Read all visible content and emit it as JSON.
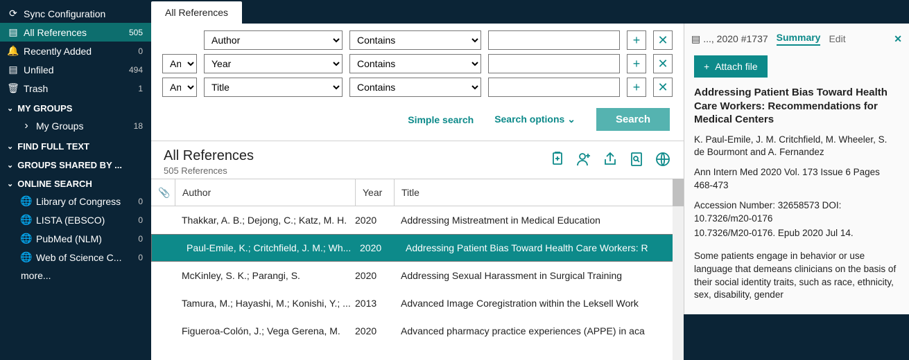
{
  "sidebar": {
    "sync": "Sync Configuration",
    "items": [
      {
        "icon": "⎘",
        "label": "All References",
        "count": "505",
        "active": true
      },
      {
        "icon": "🔔",
        "label": "Recently Added",
        "count": "0"
      },
      {
        "icon": "⎘",
        "label": "Unfiled",
        "count": "494"
      },
      {
        "icon": "🗑",
        "label": "Trash",
        "count": "1"
      }
    ],
    "my_groups_header": "MY GROUPS",
    "my_groups": [
      {
        "label": "My Groups",
        "count": "18"
      }
    ],
    "find_full_text_header": "FIND FULL TEXT",
    "groups_shared_header": "GROUPS SHARED BY ...",
    "online_search_header": "ONLINE SEARCH",
    "online_sources": [
      {
        "label": "Library of Congress",
        "count": "0"
      },
      {
        "label": "LISTA (EBSCO)",
        "count": "0"
      },
      {
        "label": "PubMed (NLM)",
        "count": "0"
      },
      {
        "label": "Web of Science C...",
        "count": "0"
      }
    ],
    "more": "more..."
  },
  "tab": {
    "label": "All References"
  },
  "search": {
    "rows": [
      {
        "joiner": "",
        "field": "Author",
        "op": "Contains",
        "value": ""
      },
      {
        "joiner": "And",
        "field": "Year",
        "op": "Contains",
        "value": ""
      },
      {
        "joiner": "And",
        "field": "Title",
        "op": "Contains",
        "value": ""
      }
    ],
    "simple": "Simple search",
    "options": "Search options",
    "search_btn": "Search"
  },
  "list": {
    "title": "All References",
    "subtitle": "505 References",
    "columns": {
      "author": "Author",
      "year": "Year",
      "title": "Title"
    },
    "rows": [
      {
        "author": "Thakkar, A. B.; Dejong, C.; Katz, M. H.",
        "year": "2020",
        "title": "Addressing Mistreatment in Medical Education",
        "selected": false
      },
      {
        "author": "Paul-Emile, K.; Critchfield, J. M.; Wh...",
        "year": "2020",
        "title": "Addressing Patient Bias Toward Health Care Workers: R",
        "selected": true
      },
      {
        "author": "McKinley, S. K.; Parangi, S.",
        "year": "2020",
        "title": "Addressing Sexual Harassment in Surgical Training",
        "selected": false
      },
      {
        "author": "Tamura, M.; Hayashi, M.; Konishi, Y.; ...",
        "year": "2013",
        "title": "Advanced Image Coregistration within the Leksell Work",
        "selected": false
      },
      {
        "author": "Figueroa-Colón, J.; Vega Gerena, M.",
        "year": "2020",
        "title": "Advanced pharmacy practice experiences (APPE) in aca",
        "selected": false
      }
    ]
  },
  "detail": {
    "ref_label": "..., 2020 #1737",
    "tab_summary": "Summary",
    "tab_edit": "Edit",
    "attach": "Attach file",
    "title": "Addressing Patient Bias Toward Health Care Workers: Recommendations for Medical Centers",
    "authors": "K. Paul-Emile, J. M. Critchfield, M. Wheeler, S. de Bourmont and A. Fernandez",
    "journal": "Ann Intern Med 2020 Vol. 173 Issue 6 Pages 468-473",
    "accession": "Accession Number: 32658573 DOI: 10.7326/m20-0176",
    "doi2": "10.7326/M20-0176. Epub 2020 Jul 14.",
    "abstract": "Some patients engage in behavior or use language that demeans clinicians on the basis of their social identity traits, such as race, ethnicity, sex, disability, gender"
  }
}
